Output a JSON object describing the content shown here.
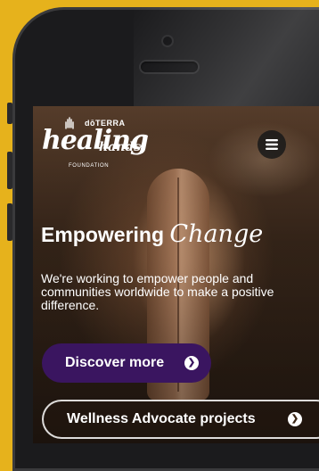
{
  "colors": {
    "background": "#e6b21c",
    "phone_body": "#1b1b1d",
    "primary_button": "#3a1560",
    "text": "#ffffff"
  },
  "logo": {
    "brand": "dōTERRA",
    "script_main": "healing",
    "script_secondary": "hands",
    "subtitle": "FOUNDATION"
  },
  "menu": {
    "icon": "hamburger-menu-icon"
  },
  "hero": {
    "headline_plain": "Empowering",
    "headline_accent": "Change",
    "body": "We're working to empower people and communities worldwide to make a positive difference."
  },
  "buttons": {
    "primary_label": "Discover more",
    "secondary_label": "Wellness Advocate projects"
  }
}
